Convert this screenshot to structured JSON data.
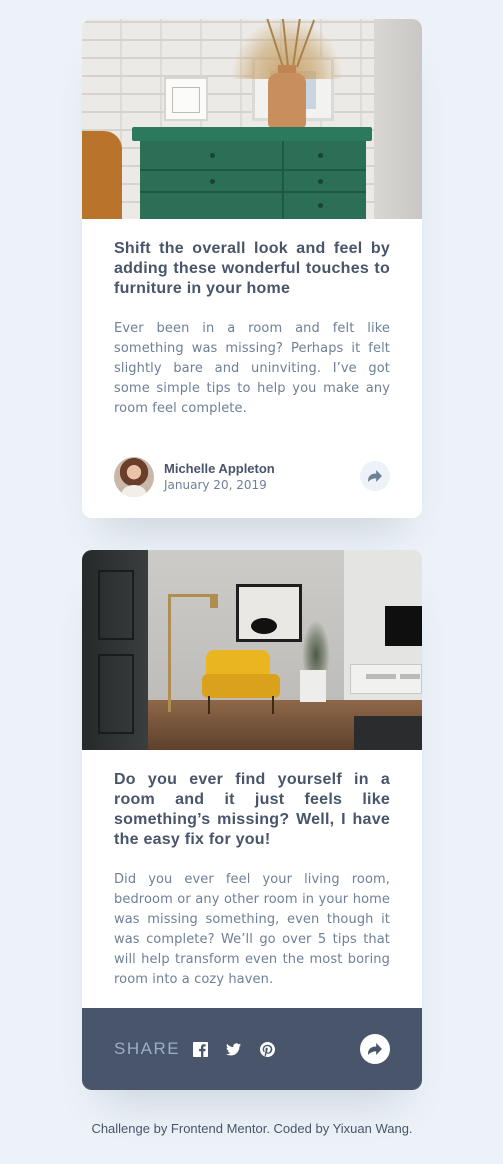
{
  "cards": [
    {
      "image_alt": "green drawers",
      "title": "Shift the overall look and feel by adding these wonderful touches to furniture in your home",
      "text": "Ever been in a room and felt like something was missing? Perhaps it felt slightly bare and uninviting. I’ve got some simple tips to help you make any room feel complete.",
      "author": {
        "name": "Michelle Appleton",
        "date": "January 20, 2019"
      },
      "share_icon": "share-arrow-icon"
    },
    {
      "image_alt": "living room",
      "title": "Do you ever find yourself in a room and it just feels like something’s missing? Well, I have the easy fix for you!",
      "text": "Did you ever feel your living room, bedroom or any other room in your home was missing something, even though it was complete? We’ll go over 5 tips that will help transform even the most boring room into a cozy haven.",
      "share": {
        "label": "SHARE",
        "icons": [
          "facebook-icon",
          "twitter-icon",
          "pinterest-icon"
        ]
      },
      "share_icon": "share-arrow-icon"
    }
  ],
  "attribution": {
    "text": "Challenge by Frontend Mentor. Coded by Yixuan Wang."
  },
  "colors": {
    "background": "#ECF2F8",
    "heading": "#48556A",
    "body_text": "#6E8098",
    "share_bar": "#48556A",
    "share_label": "#9DAEC2"
  }
}
